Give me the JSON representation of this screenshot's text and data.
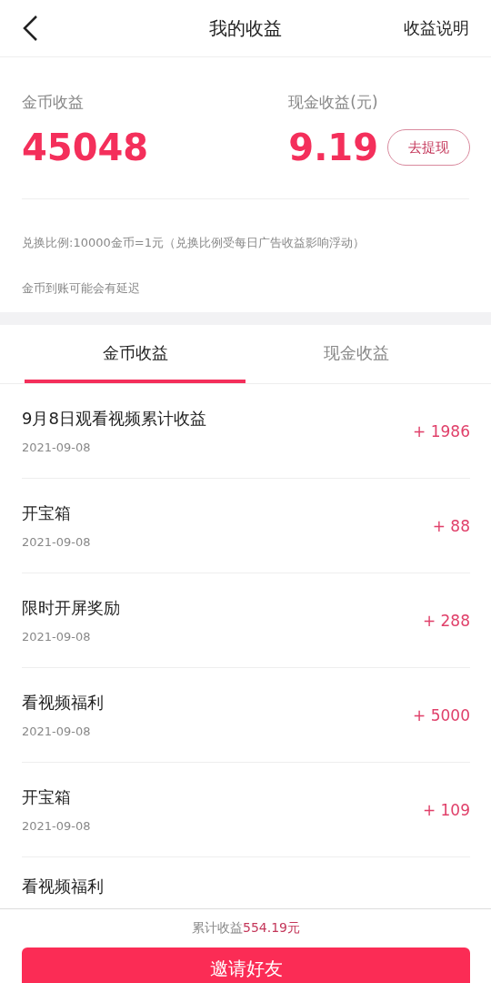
{
  "header": {
    "title": "我的收益",
    "action": "收益说明"
  },
  "summary": {
    "coin_label": "金币收益",
    "coin_value": "45048",
    "cash_label": "现金收益(元)",
    "cash_value": "9.19",
    "withdraw_button": "去提现"
  },
  "notes": [
    "兑换比例:10000金币=1元（兑换比例受每日广告收益影响浮动）",
    "金币到账可能会有延迟"
  ],
  "tabs": [
    {
      "label": "金币收益",
      "selected": true
    },
    {
      "label": "现金收益",
      "selected": false
    }
  ],
  "records": [
    {
      "title": "9月8日观看视频累计收益",
      "date": "2021-09-08",
      "amount": "+ 1986"
    },
    {
      "title": "开宝箱",
      "date": "2021-09-08",
      "amount": "+ 88"
    },
    {
      "title": "限时开屏奖励",
      "date": "2021-09-08",
      "amount": "+ 288"
    },
    {
      "title": "看视频福利",
      "date": "2021-09-08",
      "amount": "+ 5000"
    },
    {
      "title": "开宝箱",
      "date": "2021-09-08",
      "amount": "+ 109"
    },
    {
      "title": "看视频福利"
    }
  ],
  "footer": {
    "total_label": "累计收益",
    "total_value": "554.19元",
    "invite_button": "邀请好友"
  }
}
